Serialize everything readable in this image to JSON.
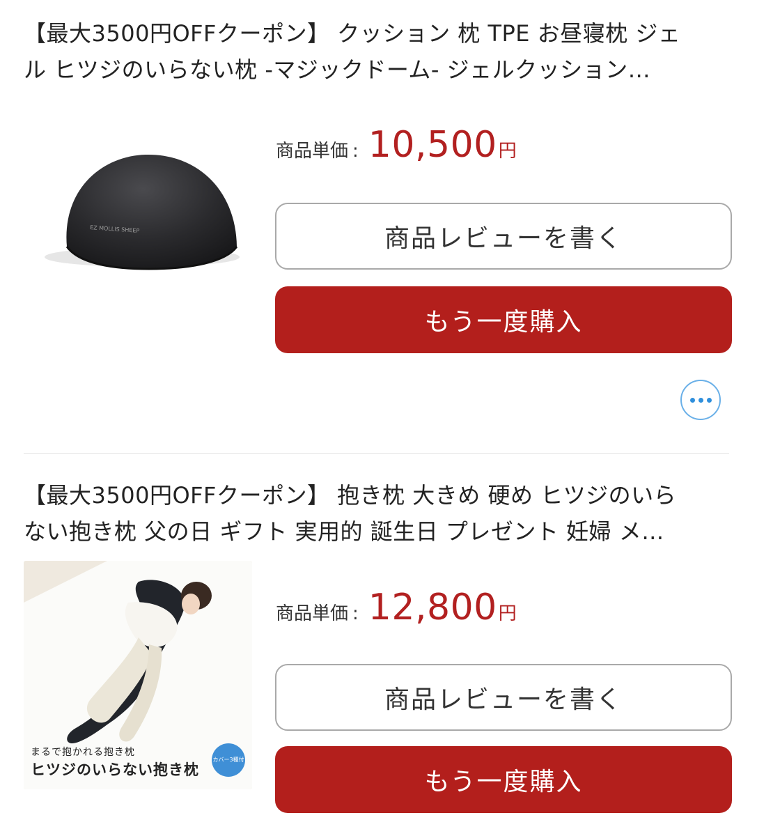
{
  "items": [
    {
      "title_line1": "【最大3500円OFFクーポン】 クッション 枕 TPE お昼寝枕 ジェ",
      "title_line2": "ル ヒツジのいらない枕 -マジックドーム- ジェルクッション…",
      "price_label": "商品単価",
      "price_colon": ":",
      "price_value": "10,500",
      "price_unit": "円",
      "review_label": "商品レビューを書く",
      "rebuy_label": "もう一度購入",
      "image_icon": "cushion-product-image"
    },
    {
      "title_line1": "【最大3500円OFFクーポン】 抱き枕 大きめ 硬め ヒツジのいら",
      "title_line2": "ない抱き枕 父の日 ギフト 実用的 誕生日 プレゼント 妊婦 メ…",
      "price_label": "商品単価",
      "price_colon": ":",
      "price_value": "12,800",
      "price_unit": "円",
      "review_label": "商品レビューを書く",
      "rebuy_label": "もう一度購入",
      "image_icon": "body-pillow-product-image",
      "image_caption_small": "まるで抱かれる抱き枕",
      "image_caption_big": "ヒツジのいらない抱き枕",
      "image_badge": "カバー3種付"
    }
  ],
  "more_menu_icon": "more-dots-icon",
  "colors": {
    "price": "#b22020",
    "rebuy_button": "#b31f1c",
    "more_icon": "#2f8fdc"
  }
}
